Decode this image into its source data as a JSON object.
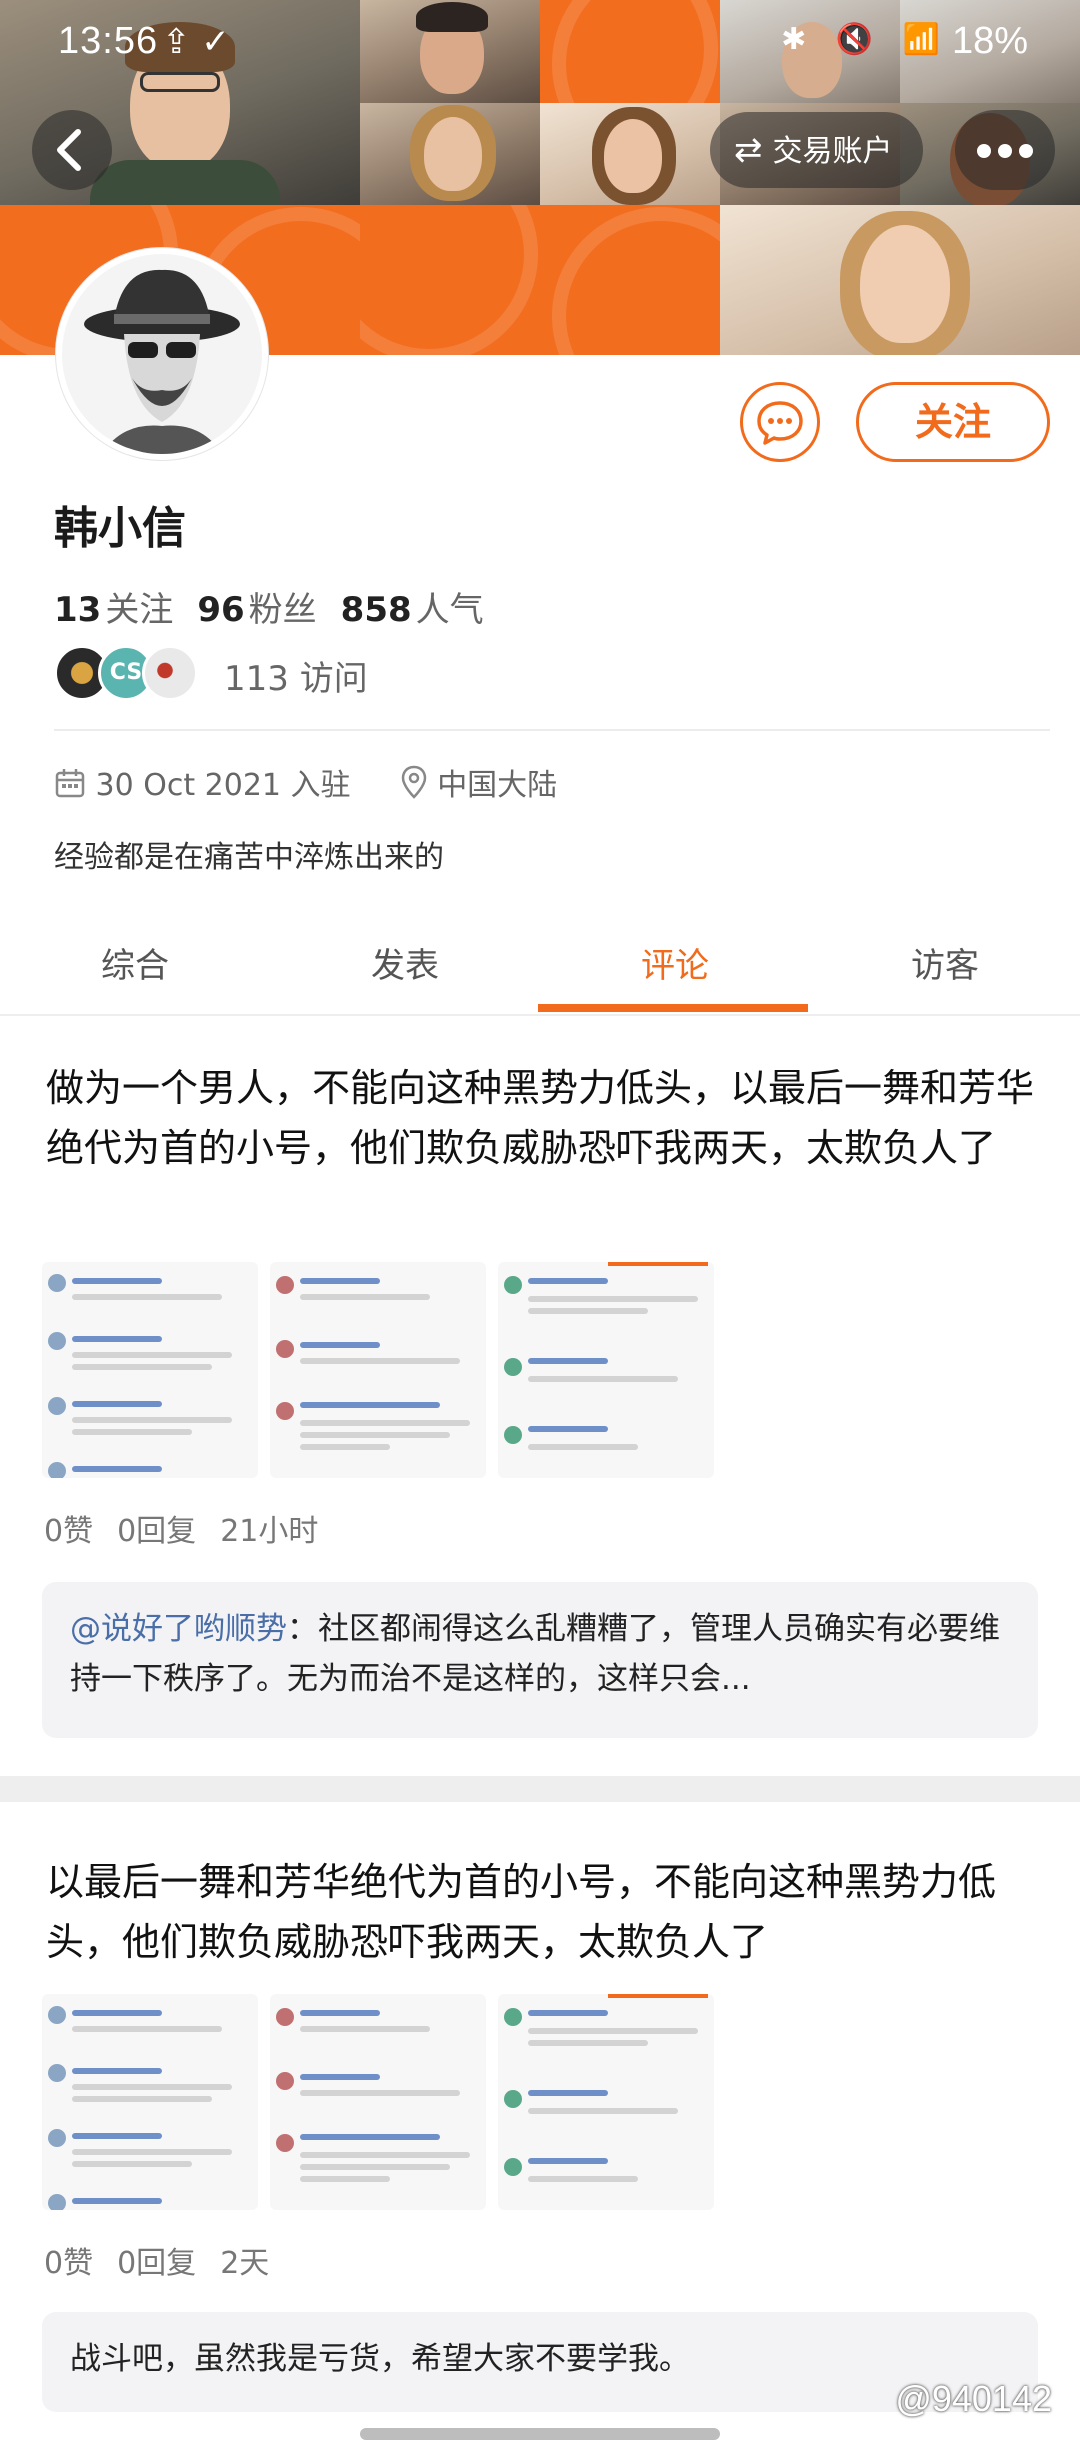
{
  "status_bar": {
    "time": "13:56",
    "network": "LTE",
    "battery": "18%"
  },
  "header": {
    "trade_account_label": "交易账户"
  },
  "profile": {
    "name": "韩小信",
    "stats": {
      "following_count": "13",
      "following_label": "关注",
      "followers_count": "96",
      "followers_label": "粉丝",
      "popularity_count": "858",
      "popularity_label": "人气"
    },
    "visits_text": "113 访问",
    "visitor_avatar_initials": "CS",
    "joined": "30 Oct 2021 入驻",
    "location": "中国大陆",
    "bio": "经验都是在痛苦中淬炼出来的",
    "follow_label": "关注"
  },
  "tabs": [
    {
      "label": "综合"
    },
    {
      "label": "发表"
    },
    {
      "label": "评论"
    },
    {
      "label": "访客"
    }
  ],
  "posts": [
    {
      "text": "做为一个男人，不能向这种黑势力低头，以最后一舞和芳华绝代为首的小号，他们欺负威胁恐吓我两天，太欺负人了",
      "likes": "0赞",
      "replies": "0回复",
      "time": "21小时",
      "reply_user": "@说好了哟顺势",
      "reply_text": "：社区都闹得这么乱糟糟了，管理人员确实有必要维持一下秩序了。无为而治不是这样的，这样只会..."
    },
    {
      "text": "以最后一舞和芳华绝代为首的小号，不能向这种黑势力低头，他们欺负威胁恐吓我两天，太欺负人了",
      "likes": "0赞",
      "replies": "0回复",
      "time": "2天",
      "reply_text": "战斗吧，虽然我是亏货，希望大家不要学我。"
    }
  ],
  "watermark": "@940142",
  "colors": {
    "accent": "#f26a1b",
    "link": "#4a6fa8"
  }
}
